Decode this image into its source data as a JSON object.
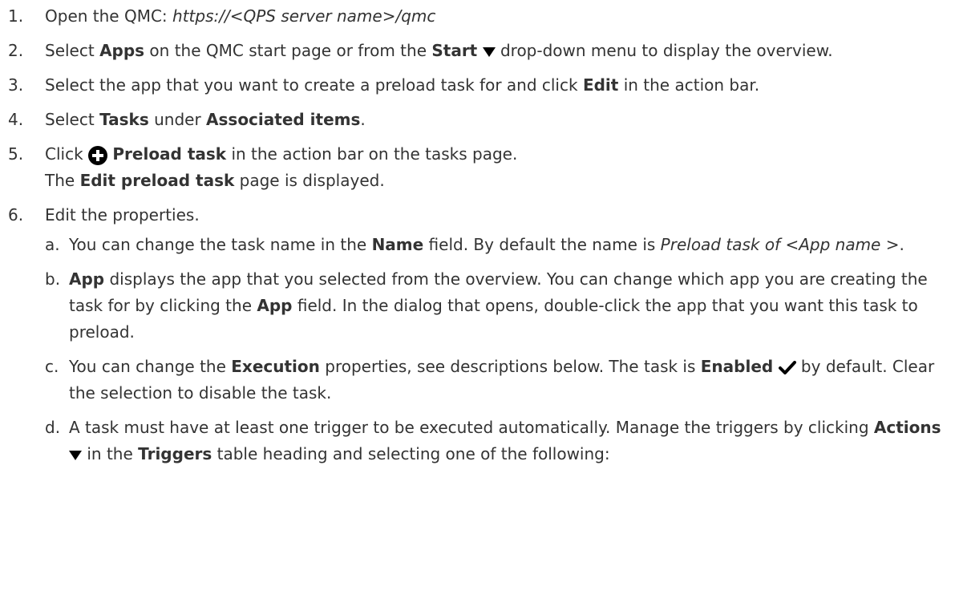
{
  "steps": [
    {
      "num": "1.",
      "t1": "Open the QMC: ",
      "t2": "https://<QPS server name>/qmc"
    },
    {
      "num": "2.",
      "t1": "Select ",
      "b1": "Apps",
      "t2": " on the QMC start page or from the ",
      "b2": "Start",
      "t3": " drop-down menu to display the overview."
    },
    {
      "num": "3.",
      "t1": "Select the app that you want to create a preload task for and click ",
      "b1": "Edit",
      "t2": " in the action bar."
    },
    {
      "num": "4.",
      "t1": "Select ",
      "b1": "Tasks",
      "t2": " under ",
      "b2": "Associated items",
      "t3": "."
    },
    {
      "num": "5.",
      "t1": "Click ",
      "b1": "Preload task",
      "t2": " in the action bar on the tasks page.",
      "t3": "The ",
      "b2": "Edit preload task",
      "t4": " page is displayed."
    },
    {
      "num": "6.",
      "t1": "Edit the properties."
    }
  ],
  "substeps": [
    {
      "num": "a.",
      "t1": "You can change the task name in the ",
      "b1": "Name",
      "t2": " field. By default the name is ",
      "i1": "Preload task of <App name >",
      "t3": "."
    },
    {
      "num": "b.",
      "b1": "App",
      "t1": " displays the app that you selected from the overview. You can change which app you are creating the task for by clicking the ",
      "b2": "App",
      "t2": " field. In the dialog that opens, double-click the app that you want this task to preload."
    },
    {
      "num": "c.",
      "t1": "You can change the ",
      "b1": "Execution",
      "t2": " properties, see descriptions below. The task is ",
      "b2": "Enabled",
      "t3": " by default. Clear the selection to disable the task."
    },
    {
      "num": "d.",
      "t1": "A task must have at least one trigger to be executed automatically. Manage the triggers by clicking ",
      "b1": "Actions",
      "t2": " in the ",
      "b2": "Triggers",
      "t3": " table heading and selecting one of the following:"
    }
  ],
  "icons": {
    "dropdown": "caret-down-icon",
    "add": "plus-circle-icon",
    "check": "checkmark-icon",
    "color": "#000000"
  }
}
